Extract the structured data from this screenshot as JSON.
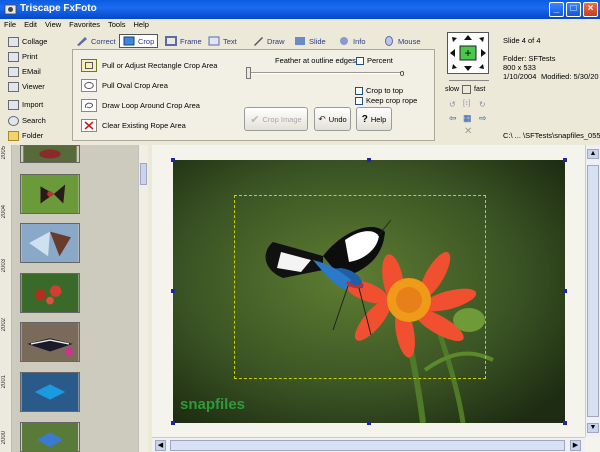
{
  "window": {
    "title": "Triscape FxFoto",
    "minimize": "_",
    "maximize": "□",
    "close": "×"
  },
  "menu": [
    "File",
    "Edit",
    "View",
    "Favorites",
    "Tools",
    "Help"
  ],
  "left_nav": [
    "Collage",
    "Print",
    "EMail",
    "Viewer",
    "Import",
    "Search",
    "Folder"
  ],
  "tabs": [
    "Correct",
    "Crop",
    "Frame",
    "Text",
    "Draw",
    "Slide",
    "Info",
    "Mouse"
  ],
  "crop": {
    "options": [
      "Pull or Adjust Rectangle Crop Area",
      "Pull Oval Crop Area",
      "Draw Loop Around Crop Area",
      "Clear Existing Rope Area"
    ],
    "feather_label": "Feather at outline edges",
    "feather_value": "0",
    "percent_label": "Percent",
    "crop_to_top_label": "Crop to top",
    "keep_crop_rope_label": "Keep crop rope",
    "crop_image_button": "Crop Image",
    "undo_button": "Undo",
    "help_button": "Help"
  },
  "speed": {
    "slow": "slow",
    "fast": "fast"
  },
  "info": {
    "slide": "Slide 4 of 4",
    "folder": "Folder: SFTests",
    "dimensions": "800 x 533",
    "date": "1/10/2004",
    "modified": "Modified: 5/30/20",
    "path": "C:\\ ... \\SFTests\\snapfiles_055.j"
  },
  "ruler_labels": [
    "2005",
    "2004",
    "2003",
    "2002",
    "2001",
    "2000"
  ],
  "watermark": "snapfiles",
  "colors": {
    "titlebar": "#0a5ce0",
    "accent": "#2a3a8a",
    "handle": "#1b2aa0",
    "crop_rect": "#c8d000"
  }
}
